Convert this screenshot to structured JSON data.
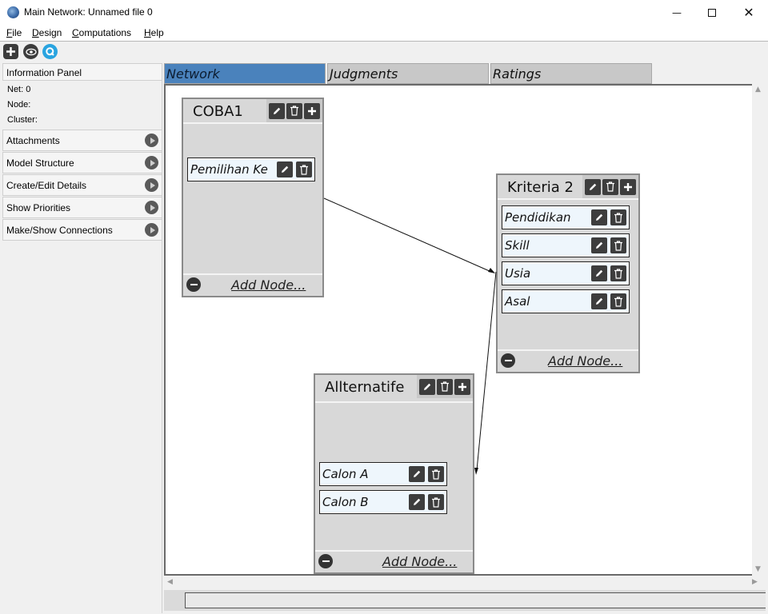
{
  "window": {
    "title": "Main Network: Unnamed file 0",
    "controls": {
      "minimize": "—",
      "close": "✕"
    }
  },
  "menu": [
    {
      "label": "File",
      "key": "F",
      "rest": "ile"
    },
    {
      "label": "Design",
      "key": "D",
      "rest": "esign"
    },
    {
      "label": "Computations",
      "key": "C",
      "rest": "omputations"
    },
    {
      "label": "Help",
      "key": "H",
      "rest": "elp"
    }
  ],
  "toolbar": {
    "icons": [
      "add-icon",
      "eye-icon",
      "q-icon"
    ]
  },
  "info_panel": {
    "header": "Information Panel",
    "net": "Net: 0",
    "node": "Node:",
    "cluster": "Cluster:",
    "sections": [
      "Attachments",
      "Model Structure",
      "Create/Edit Details",
      "Show Priorities",
      "Make/Show Connections"
    ]
  },
  "tabs": [
    {
      "label": "Network",
      "active": true
    },
    {
      "label": "Judgments",
      "active": false
    },
    {
      "label": "Ratings",
      "active": false
    }
  ],
  "clusters": [
    {
      "name": "COBA1",
      "add_node_label": "Add Node...",
      "nodes": [
        "Pemilihan Ke"
      ]
    },
    {
      "name": "Kriteria 2",
      "add_node_label": "Add Node...",
      "nodes": [
        "Pendidikan",
        "Skill",
        "Usia",
        "Asal"
      ]
    },
    {
      "name": "Allternatife",
      "add_node_label": "Add Node...",
      "nodes": [
        "Calon A",
        "Calon B"
      ]
    }
  ],
  "colors": {
    "active_tab": "#4a82bc",
    "inactive_tab": "#c8c8c8",
    "cluster_bg": "#d8d8d8",
    "node_bg": "#eef6fc",
    "icon_button": "#3d3d3d"
  }
}
